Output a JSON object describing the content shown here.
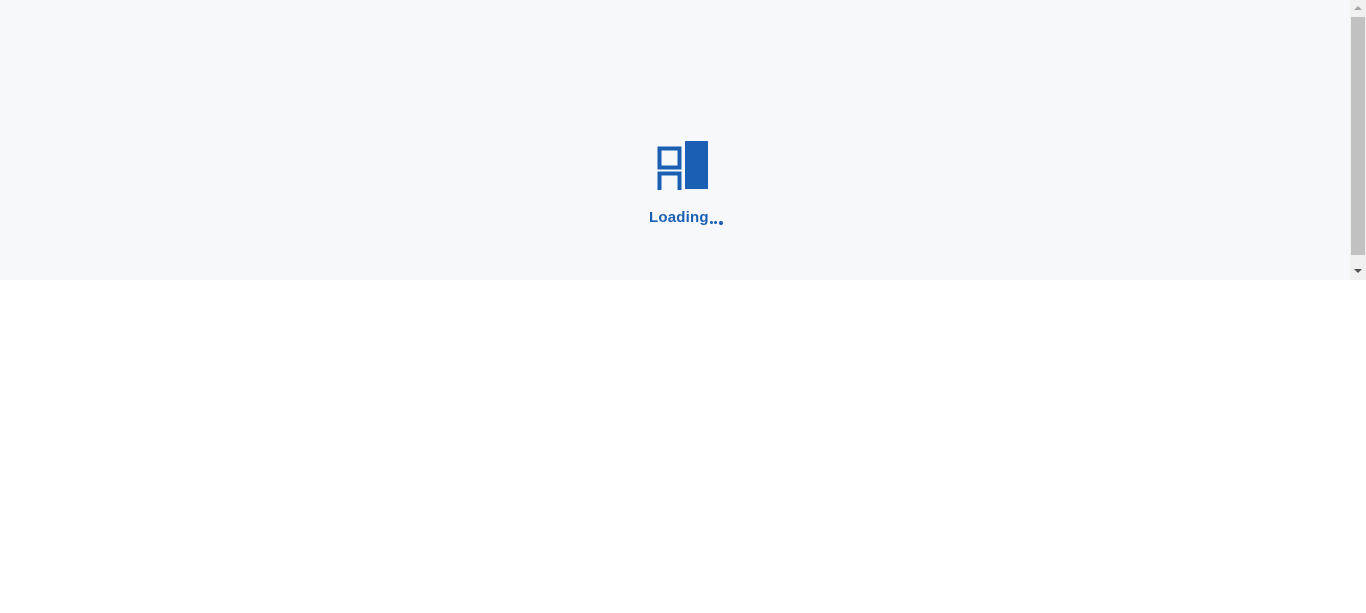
{
  "loader": {
    "text": "Loading",
    "logo_icon": "app-logo-icon",
    "accent_color": "#1a5fb4"
  },
  "colors": {
    "page_background": "#f7f8fb",
    "lower_background": "#ffffff",
    "scrollbar_track": "#f1f1f1",
    "scrollbar_thumb": "#c1c1c1"
  },
  "scrollbar": {
    "up_icon": "scroll-up-arrow-icon",
    "down_icon": "scroll-down-arrow-icon"
  }
}
